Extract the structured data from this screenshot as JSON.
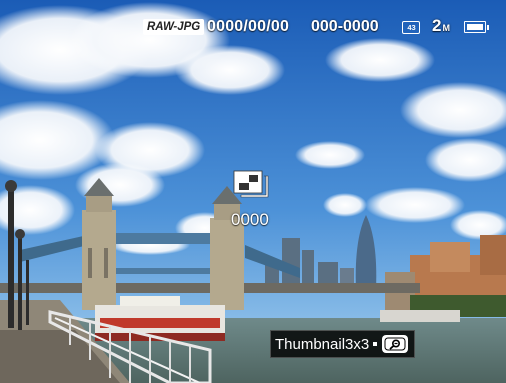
{
  "status_bar": {
    "format": "RAW-JPG",
    "date": "0000/00/00",
    "file_number": "000-0000",
    "aspect_icon": "ratio-4-3-icon",
    "image_size": "2",
    "image_size_unit": "M",
    "battery_icon": "battery-full-icon"
  },
  "center": {
    "icon": "multi-frame-icon",
    "counter": "0000"
  },
  "hint": {
    "label": "Thumbnail3x3",
    "button_icon": "zoom-out-lever-icon"
  },
  "colors": {
    "sky_top": "#1c5fb8",
    "sky_bottom": "#8ec3ec",
    "osd_text": "#ffffff",
    "hint_bg": "#000000"
  }
}
